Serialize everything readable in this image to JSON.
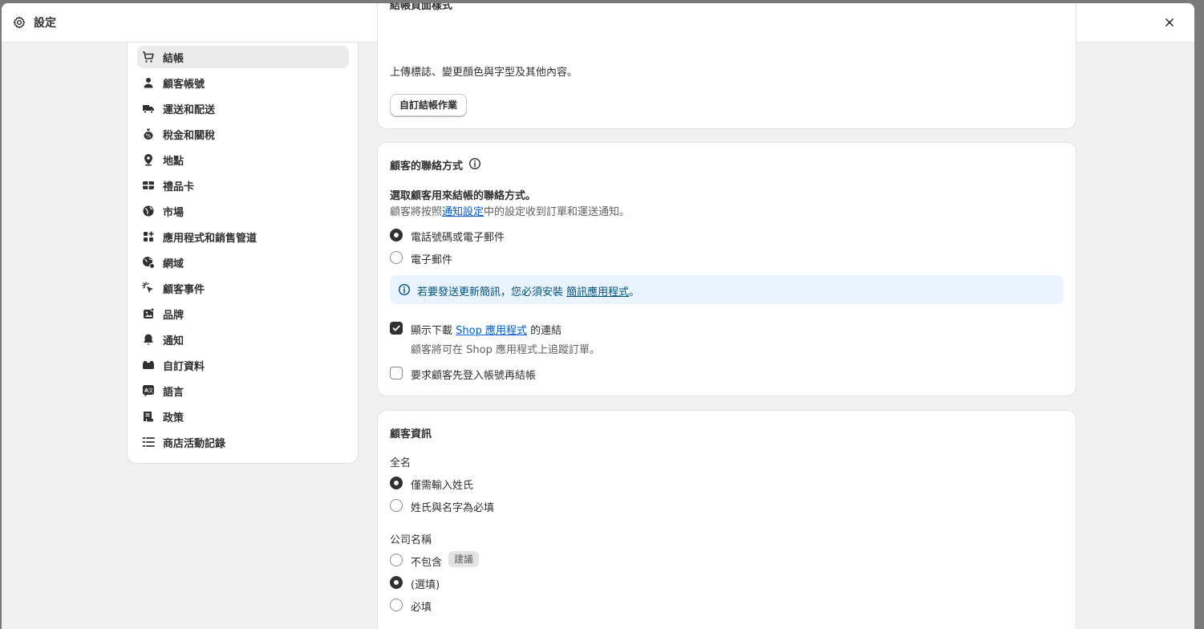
{
  "window": {
    "title": "設定",
    "close_icon": "close-icon",
    "settings_icon": "gear-icon"
  },
  "sidebar": {
    "items": [
      {
        "label": "結帳",
        "icon": "cart-icon",
        "active": true
      },
      {
        "label": "顧客帳號",
        "icon": "person-icon"
      },
      {
        "label": "運送和配送",
        "icon": "truck-icon"
      },
      {
        "label": "稅金和關稅",
        "icon": "money-bag-icon"
      },
      {
        "label": "地點",
        "icon": "location-pin-icon"
      },
      {
        "label": "禮品卡",
        "icon": "gift-card-icon"
      },
      {
        "label": "市場",
        "icon": "globe-icon"
      },
      {
        "label": "應用程式和銷售管道",
        "icon": "apps-icon"
      },
      {
        "label": "網域",
        "icon": "globe-network-icon"
      },
      {
        "label": "顧客事件",
        "icon": "cursor-click-icon"
      },
      {
        "label": "品牌",
        "icon": "image-icon"
      },
      {
        "label": "通知",
        "icon": "bell-icon"
      },
      {
        "label": "自訂資料",
        "icon": "database-icon"
      },
      {
        "label": "語言",
        "icon": "language-icon"
      },
      {
        "label": "政策",
        "icon": "receipt-icon"
      },
      {
        "label": "商店活動記錄",
        "icon": "list-icon"
      }
    ]
  },
  "checkout_style": {
    "heading_partial": "結帳頁面樣式",
    "description": "上傳標誌、變更顏色與字型及其他內容。",
    "customize_button": "自訂結帳作業"
  },
  "contact": {
    "heading": "顧客的聯絡方式",
    "info_icon": "info-icon",
    "question": "選取顧客用來結帳的聯絡方式。",
    "desc_before": "顧客將按照",
    "desc_link": "通知設定",
    "desc_after": "中的設定收到訂單和運送通知。",
    "options": [
      {
        "label": "電話號碼或電子郵件",
        "selected": true
      },
      {
        "label": "電子郵件",
        "selected": false
      }
    ],
    "banner": {
      "before": "若要發送更新簡訊，您必須安裝 ",
      "link": "簡訊應用程式",
      "after": "。"
    },
    "shop_app": {
      "before": "顯示下載 ",
      "link": "Shop 應用程式",
      "after": " 的連結",
      "checked": true,
      "help": "顧客將可在 Shop 應用程式上追蹤訂單。"
    },
    "require_login": {
      "label": "要求顧客先登入帳號再結帳",
      "checked": false
    }
  },
  "customer_info": {
    "heading": "顧客資訊",
    "full_name": {
      "label": "全名",
      "options": [
        {
          "label": "僅需輸入姓氏",
          "selected": true
        },
        {
          "label": "姓氏與名字為必填",
          "selected": false
        }
      ]
    },
    "company": {
      "label": "公司名稱",
      "options": [
        {
          "label": "不包含",
          "selected": false,
          "badge": "建議"
        },
        {
          "label": "(選填)",
          "selected": true
        },
        {
          "label": "必填",
          "selected": false
        }
      ]
    }
  },
  "colors": {
    "accent_link": "#005bd3",
    "banner_bg": "#eaf4ff",
    "selected": "#303030"
  }
}
